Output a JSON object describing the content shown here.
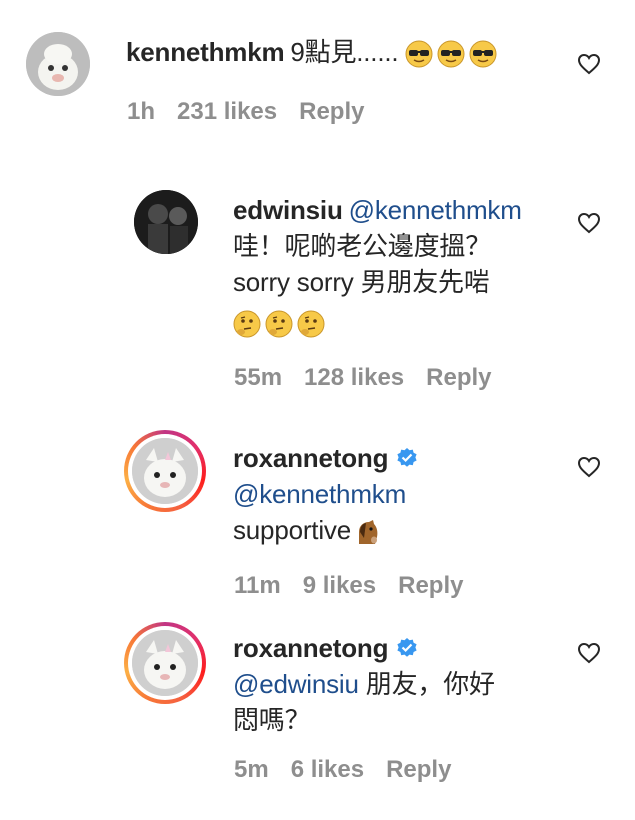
{
  "comments": [
    {
      "username": "kennethmkm",
      "mention": "",
      "text": "9點見......",
      "emoji": [
        "sunglasses-face",
        "sunglasses-face",
        "sunglasses-face"
      ],
      "time": "1h",
      "likes": "231 likes",
      "reply": "Reply"
    },
    {
      "username": "edwinsiu",
      "mention": "@kennethmkm",
      "line1": "哇！呢啲老公邊度搵？",
      "line2": "sorry sorry 男朋友先啱",
      "emoji": [
        "thinking-face",
        "thinking-face",
        "thinking-face"
      ],
      "time": "55m",
      "likes": "128 likes",
      "reply": "Reply"
    },
    {
      "username": "roxannetong",
      "mention": "@kennethmkm",
      "text": "supportive",
      "emoji": [
        "horse-face"
      ],
      "time": "11m",
      "likes": "9 likes",
      "reply": "Reply"
    },
    {
      "username": "roxannetong",
      "mention": "@edwinsiu",
      "text_inline": "朋友，你好",
      "line2": "悶嗎？",
      "time": "5m",
      "likes": "6 likes",
      "reply": "Reply"
    }
  ],
  "colors": {
    "mention": "#1f4e8c",
    "meta": "#8e8e8e",
    "verified": "#3897f0"
  }
}
